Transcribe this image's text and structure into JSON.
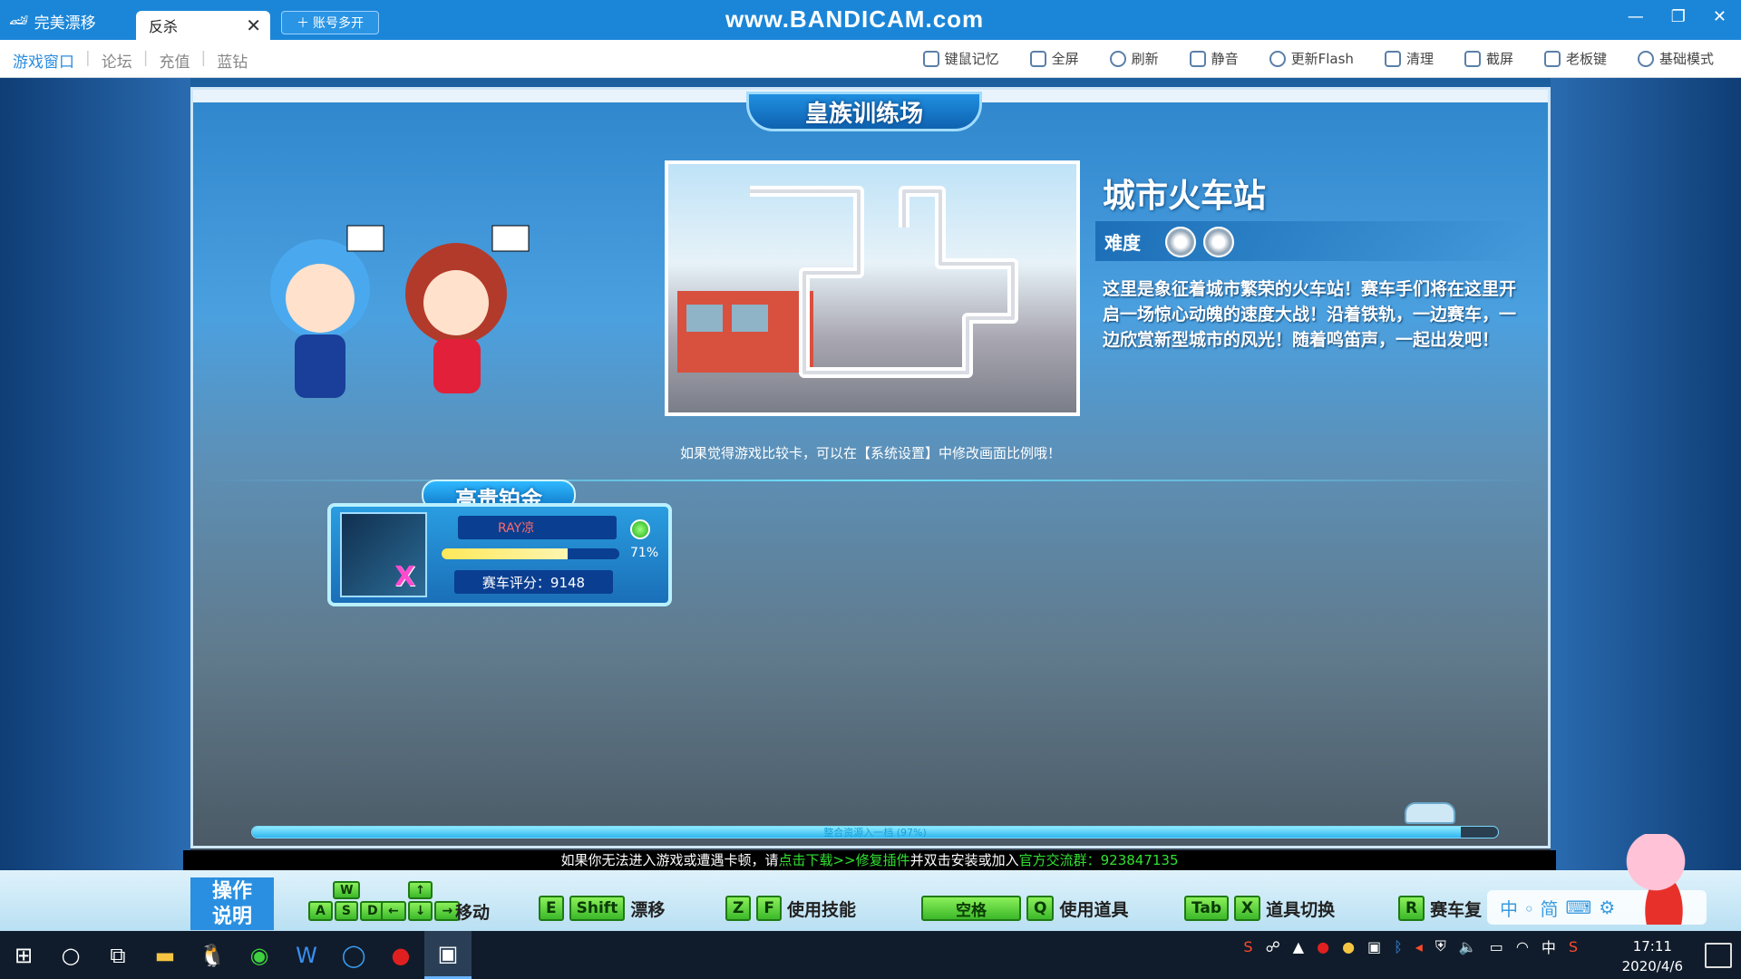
{
  "titlebar": {
    "app_name": "完美漂移",
    "active_tab": "反杀",
    "new_tab_label": "账号多开",
    "watermark": "www.BANDICAM.com"
  },
  "toolbar": {
    "left": [
      {
        "label": "游戏窗口"
      },
      {
        "label": "论坛"
      },
      {
        "label": "充值"
      },
      {
        "label": "蓝钻"
      }
    ],
    "right": [
      {
        "label": "键鼠记忆",
        "icon": "keyboard-memory-icon"
      },
      {
        "label": "全屏",
        "icon": "fullscreen-icon"
      },
      {
        "label": "刷新",
        "icon": "refresh-icon"
      },
      {
        "label": "静音",
        "icon": "mute-icon"
      },
      {
        "label": "更新Flash",
        "icon": "flash-icon"
      },
      {
        "label": "清理",
        "icon": "trash-icon"
      },
      {
        "label": "截屏",
        "icon": "screenshot-icon"
      },
      {
        "label": "老板键",
        "icon": "boss-key-icon"
      },
      {
        "label": "基础模式",
        "icon": "basic-mode-icon"
      }
    ]
  },
  "game": {
    "panel_title": "皇族训练场",
    "track_name": "城市火车站",
    "difficulty_label": "难度",
    "difficulty_level": 2,
    "description": "这里是象征着城市繁荣的火车站！赛车手们将在这里开启一场惊心动魄的速度大战！沿着铁轨，一边赛车，一边欣赏新型城市的风光！随着鸣笛声，一起出发吧！",
    "hint": "如果觉得游戏比较卡，可以在【系统设置】中修改画面比例哦！",
    "player": {
      "rank": "高贵铂金",
      "name": "RAY凉",
      "progress_pct": 0.71,
      "progress_label": "71%",
      "score_label": "赛车评分：9148"
    },
    "loading": {
      "text": "整合资源入一档    (97%)",
      "progress": 0.97
    }
  },
  "notice": {
    "prefix": "如果你无法进入游戏或遭遇卡顿，请",
    "link": "点击下载>>修复插件",
    "middle": "并双击安装或加入",
    "group": "官方交流群：923847135"
  },
  "instructions": {
    "title_line1": "操作",
    "title_line2": "说明",
    "groups": [
      {
        "keys": [
          "W",
          "A",
          "S",
          "D"
        ],
        "arrows": [
          "↑",
          "←",
          "↓",
          "→"
        ],
        "label": "移动"
      },
      {
        "keys": [
          "E",
          "Shift"
        ],
        "label": "漂移"
      },
      {
        "keys": [
          "Z",
          "F"
        ],
        "label": "使用技能"
      },
      {
        "keys": [
          "空格",
          "Q"
        ],
        "label": "使用道具"
      },
      {
        "keys": [
          "Tab",
          "X"
        ],
        "label": "道具切换"
      },
      {
        "keys": [
          "R"
        ],
        "label": "赛车复"
      }
    ]
  },
  "ime": {
    "text": "中 ◦ 简"
  },
  "taskbar": {
    "time": "17:11",
    "date": "2020/4/6",
    "ime_mode": "中"
  }
}
